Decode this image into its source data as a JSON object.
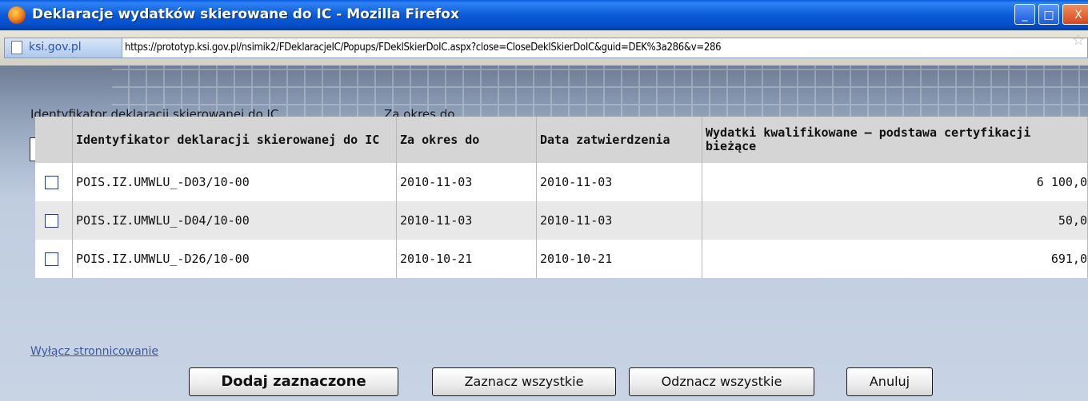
{
  "window": {
    "title": "Deklaracje wydatków skierowane do IC - Mozilla Firefox",
    "minimize": "_",
    "maximize": "□",
    "close": "X"
  },
  "urlbar": {
    "site": "ksi.gov.pl",
    "url": "https://prototyp.ksi.gov.pl/nsimik2/FDeklaracjeIC/Popups/FDeklSkierDoIC.aspx?close=CloseDeklSkierDoIC&guid=DEK%3a286&v=286"
  },
  "filters": {
    "id_label": "Identyfikator deklaracji skierowanej do IC",
    "id_value": "",
    "period_label": "Za okres do",
    "period_value": ""
  },
  "table": {
    "headers": {
      "id": "Identyfikator deklaracji skierowanej do IC",
      "period": "Za okres do",
      "approval": "Data zatwierdzenia",
      "expenses": "Wydatki kwalifikowane – podstawa certyfikacji bieżące"
    },
    "rows": [
      {
        "id": "POIS.IZ.UMWLU_-D03/10-00",
        "period": "2010-11-03",
        "approval": "2010-11-03",
        "expenses": "6 100,0"
      },
      {
        "id": "POIS.IZ.UMWLU_-D04/10-00",
        "period": "2010-11-03",
        "approval": "2010-11-03",
        "expenses": "50,0"
      },
      {
        "id": "POIS.IZ.UMWLU_-D26/10-00",
        "period": "2010-10-21",
        "approval": "2010-10-21",
        "expenses": "691,0"
      }
    ]
  },
  "paging_link": "Wyłącz stronnicowanie",
  "buttons": {
    "add": "Dodaj zaznaczone",
    "select_all": "Zaznacz wszystkie",
    "deselect_all": "Odznacz wszystkie",
    "cancel": "Anuluj"
  }
}
